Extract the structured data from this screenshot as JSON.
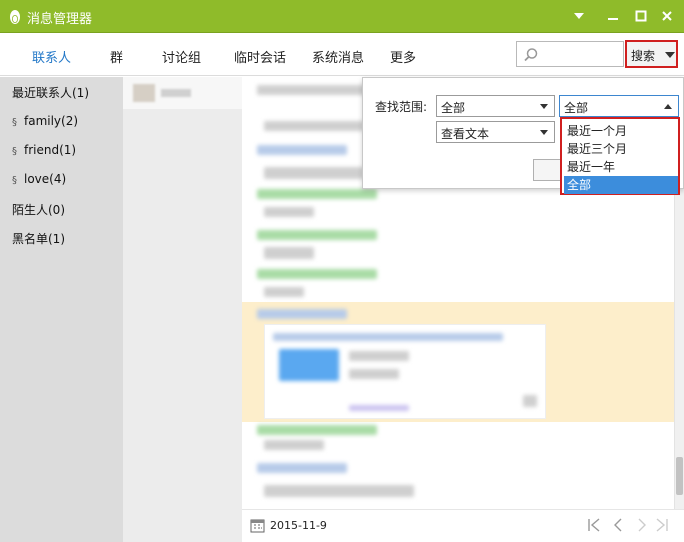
{
  "window": {
    "title": "消息管理器",
    "accent_color": "#8fbb2a"
  },
  "tabs": [
    {
      "label": "联系人",
      "active": true
    },
    {
      "label": "群"
    },
    {
      "label": "讨论组"
    },
    {
      "label": "临时会话"
    },
    {
      "label": "系统消息"
    },
    {
      "label": "更多"
    }
  ],
  "search": {
    "placeholder": "",
    "button_label": "搜索"
  },
  "sidebar": {
    "items": [
      {
        "label": "最近联系人(1)",
        "icon": ""
      },
      {
        "label": "family(2)",
        "icon": "group-icon"
      },
      {
        "label": "friend(1)",
        "icon": "group-icon"
      },
      {
        "label": "love(4)",
        "icon": "group-icon"
      },
      {
        "label": "陌生人(0)",
        "icon": ""
      },
      {
        "label": "黑名单(1)",
        "icon": ""
      }
    ]
  },
  "search_panel": {
    "range_label": "查找范围:",
    "scope_value": "全部",
    "time_value": "全部",
    "type_value": "查看文本"
  },
  "time_dropdown": {
    "options": [
      "最近一个月",
      "最近三个月",
      "最近一年",
      "全部"
    ],
    "selected": "全部"
  },
  "footer": {
    "date": "2015-11-9"
  }
}
